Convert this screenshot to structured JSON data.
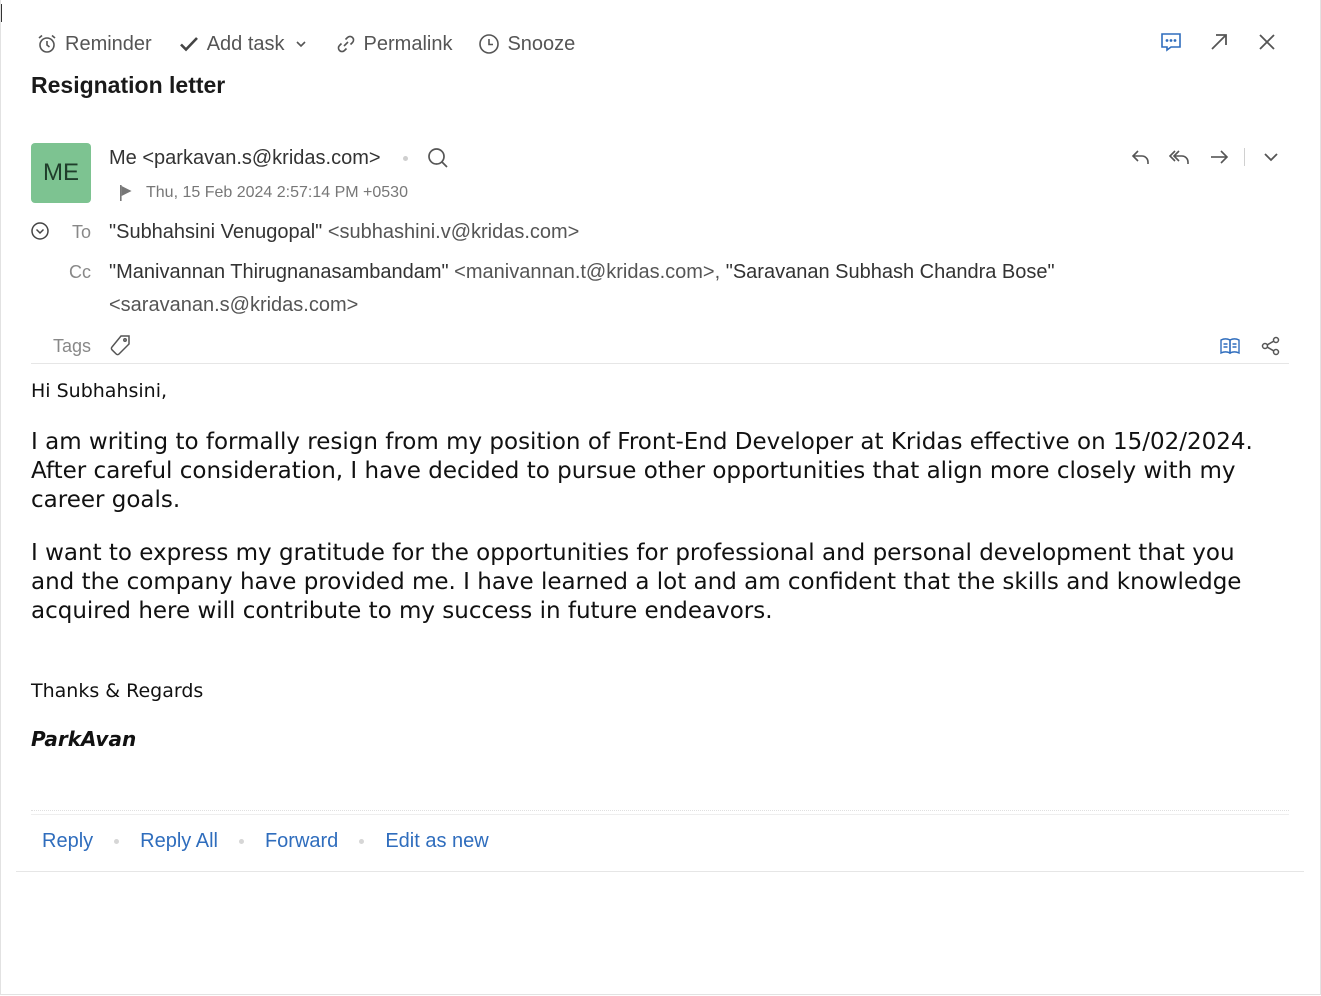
{
  "toolbar": {
    "reminder_label": "Reminder",
    "add_task_label": "Add task",
    "permalink_label": "Permalink",
    "snooze_label": "Snooze",
    "icons": [
      "alarm-clock-icon",
      "checkmark-icon",
      "chevron-down-icon",
      "link-icon",
      "clock-icon",
      "chat-icon",
      "pop-out-icon",
      "close-icon"
    ]
  },
  "subject": "Resignation letter",
  "message": {
    "avatar_initials": "ME",
    "avatar_color": "#7dc391",
    "from_name": "Me",
    "from_email": "<parkavan.s@kridas.com>",
    "date": "Thu, 15 Feb 2024 2:57:14 PM +0530",
    "to_label": "To",
    "to_name": "\"Subhahsini Venugopal\"",
    "to_email": "<subhashini.v@kridas.com>",
    "cc_label": "Cc",
    "cc_name_1": "\"Manivannan Thirugnanasambandam\"",
    "cc_email_1": "<manivannan.t@kridas.com>,",
    "cc_name_2": "\"Saravanan Subhash Chandra Bose\"",
    "cc_email_2": "<saravanan.s@kridas.com>",
    "tags_label": "Tags"
  },
  "body": {
    "greeting": "Hi Subhahsini,",
    "paragraph_1": "I am writing to formally resign from my position of Front-End Developer at Kridas effective on 15/02/2024. After careful consideration, I have decided to pursue other opportunities that align more closely with my career goals.",
    "paragraph_2": "I want to express my gratitude for the opportunities for professional and personal development that you and the company have provided me. I have learned a lot and am confident that the skills and knowledge acquired here will contribute to my success in future endeavors.",
    "closing": "Thanks & Regards",
    "signature": "ParkAvan"
  },
  "footer": {
    "reply": "Reply",
    "reply_all": "Reply All",
    "forward": "Forward",
    "edit_as_new": "Edit as new"
  },
  "colors": {
    "link": "#2f6dbd",
    "accent_icon": "#2f6dbd",
    "text": "#333333"
  }
}
